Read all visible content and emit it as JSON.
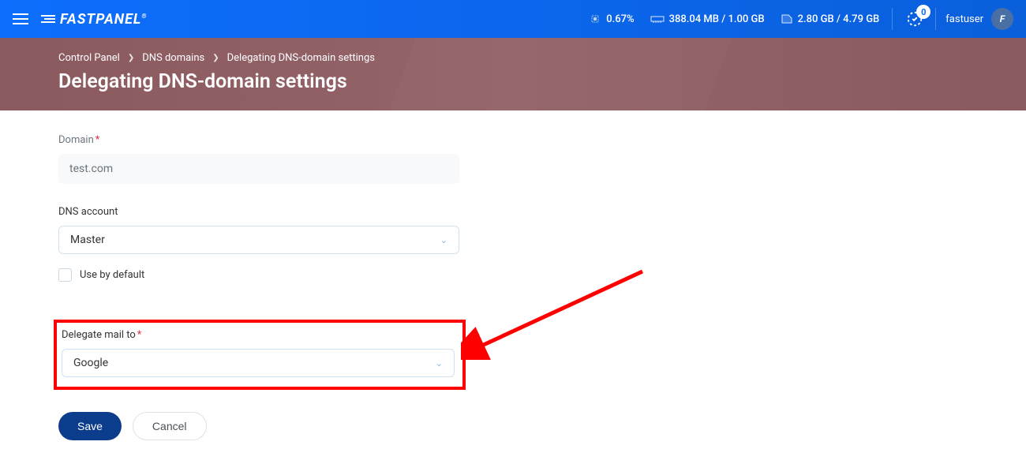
{
  "header": {
    "logo_text": "FASTPANEL",
    "stats": {
      "cpu_percent": "0.67%",
      "memory": "388.04 MB / 1.00 GB",
      "disk": "2.80 GB / 4.79 GB"
    },
    "notif_count": "0",
    "username": "fastuser"
  },
  "breadcrumb": {
    "items": [
      {
        "label": "Control Panel"
      },
      {
        "label": "DNS domains"
      },
      {
        "label": "Delegating DNS-domain settings"
      }
    ]
  },
  "page_title": "Delegating DNS-domain settings",
  "form": {
    "domain_label": "Domain",
    "domain_value": "test.com",
    "dns_account_label": "DNS account",
    "dns_account_value": "Master",
    "use_default_label": "Use by default",
    "delegate_mail_label": "Delegate mail to",
    "delegate_mail_value": "Google",
    "save_label": "Save",
    "cancel_label": "Cancel"
  }
}
